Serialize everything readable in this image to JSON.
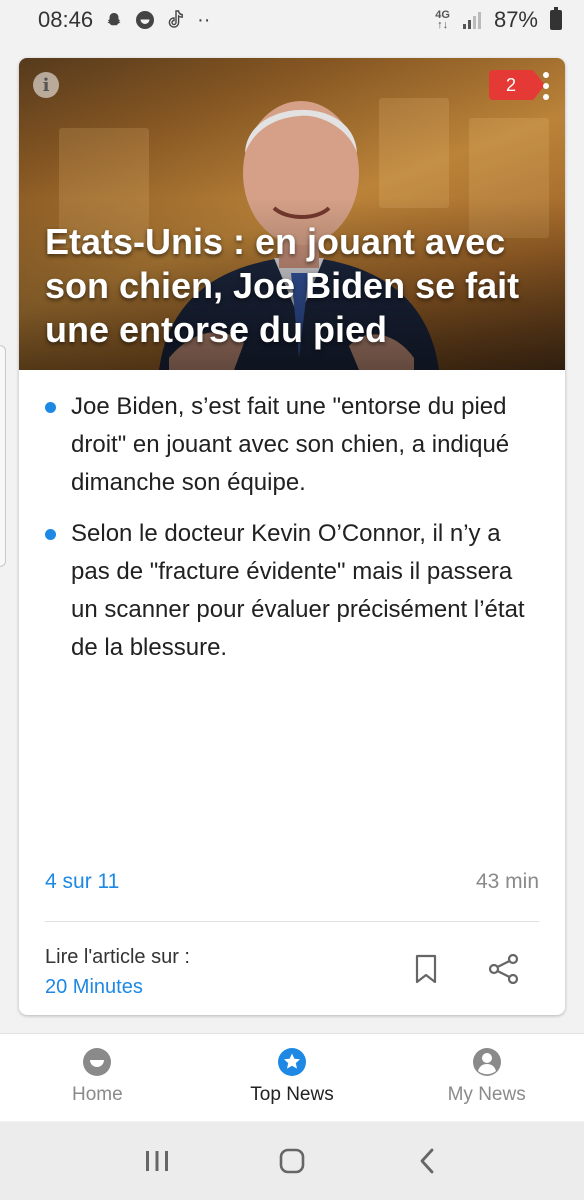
{
  "status_bar": {
    "time": "08:46",
    "notification_icons": [
      "snapchat-icon",
      "app-face-icon",
      "tiktok-icon",
      "more-notifications-icon"
    ],
    "more_notifications_text": "··",
    "network_type_top": "4G",
    "network_type_bottom": "↑↓",
    "battery": "87%"
  },
  "card": {
    "info_label": "i",
    "badge_count": "2",
    "headline": "Etats-Unis : en jouant avec son chien, Joe Biden se fait une entorse du pied",
    "bullets": [
      "Joe Biden, s’est fait une \"entorse du pied droit\" en jouant avec son chien, a indiqué dimanche son équipe.",
      "Selon le docteur Kevin O’Connor, il n’y a pas de \"fracture évidente\" mais il passera un scanner pour évaluer précisément l’état de la blessure."
    ],
    "position": "4 sur 11",
    "age": "43 min",
    "read_on_label": "Lire l'article sur :",
    "source_name": "20 Minutes"
  },
  "bottom_nav": [
    {
      "label": "Home",
      "icon": "smiley-icon",
      "active": false
    },
    {
      "label": "Top News",
      "icon": "star-icon",
      "active": true
    },
    {
      "label": "My News",
      "icon": "person-icon",
      "active": false
    }
  ],
  "colors": {
    "accent_blue": "#1e88e5",
    "badge_red": "#e53935",
    "muted_gray": "#8a8a8a"
  }
}
